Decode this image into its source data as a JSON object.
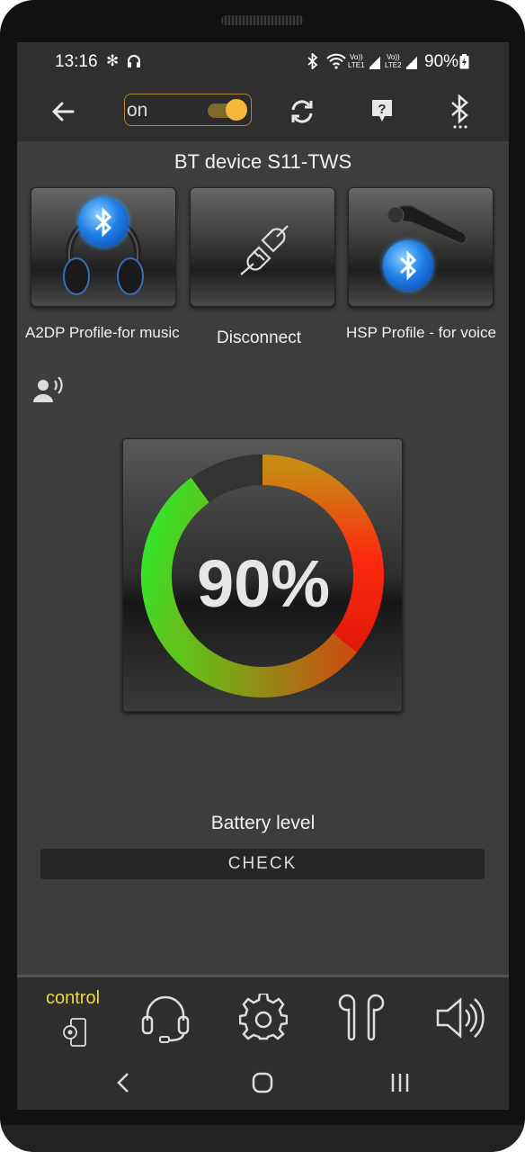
{
  "status_bar": {
    "time": "13:16",
    "battery_percent": "90%",
    "icons": [
      "fan-icon",
      "headphones-icon",
      "bluetooth-icon",
      "wifi-icon",
      "volte-lte1-signal-icon",
      "volte-lte2-signal-icon",
      "battery-charging-icon"
    ],
    "lte1": "LTE1",
    "lte2": "LTE2",
    "volte": "Vo))"
  },
  "toolbar": {
    "toggle_label": "on",
    "toggle_state": "on",
    "icons": [
      "back-arrow-icon",
      "refresh-icon",
      "help-icon",
      "bluetooth-settings-icon"
    ],
    "accent": "#f7b73a"
  },
  "device": {
    "title": "BT device S11-TWS"
  },
  "profiles": [
    {
      "label": "A2DP Profile-for music",
      "icon": "bluetooth-headphones-icon"
    },
    {
      "label": "Disconnect",
      "icon": "unplug-icon"
    },
    {
      "label": "HSP Profile - for voice",
      "icon": "bluetooth-headset-icon"
    }
  ],
  "battery": {
    "level": 90,
    "display": "90%",
    "label": "Battery level",
    "check_label": "CHECK"
  },
  "bottom_nav": {
    "active_label": "control",
    "items": [
      "control-icon",
      "headset-icon",
      "settings-gear-icon",
      "earbuds-icon",
      "speaker-volume-icon"
    ],
    "active_color": "#f1d54a"
  },
  "system_nav": {
    "icons": [
      "back-nav-icon",
      "home-nav-icon",
      "recents-nav-icon"
    ]
  }
}
